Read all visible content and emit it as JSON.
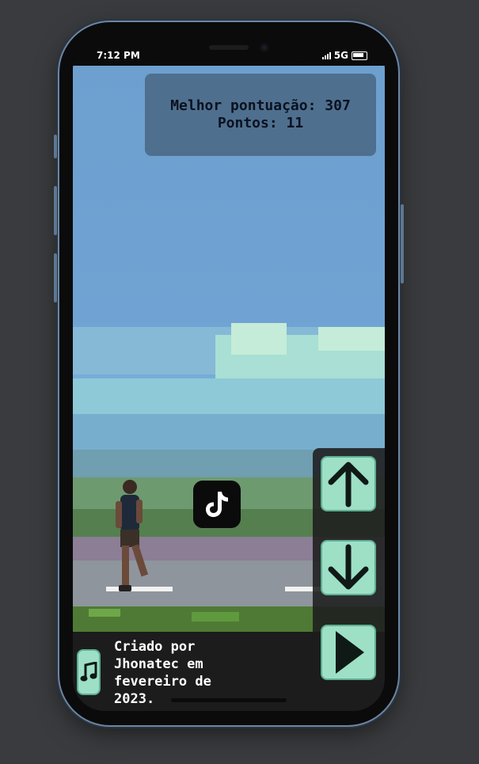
{
  "status_bar": {
    "time": "7:12 PM",
    "network": "5G",
    "icons": [
      "signal-icon",
      "battery-icon"
    ]
  },
  "game": {
    "best_score_label": "Melhor pontuação: 307",
    "points_label": "Pontos: 11",
    "center_icon": "tiktok-icon"
  },
  "controls": {
    "up": "arrow-up-icon",
    "down": "arrow-down-icon",
    "play": "play-icon"
  },
  "footer": {
    "music_icon": "music-note-icon",
    "credit": "Criado por Jhonatec em fevereiro de 2023."
  },
  "colors": {
    "button_fill": "#9de0c6",
    "button_border": "#5fae93",
    "panel_bg": "#1c1c1c",
    "sky": "#6d9fcf"
  }
}
